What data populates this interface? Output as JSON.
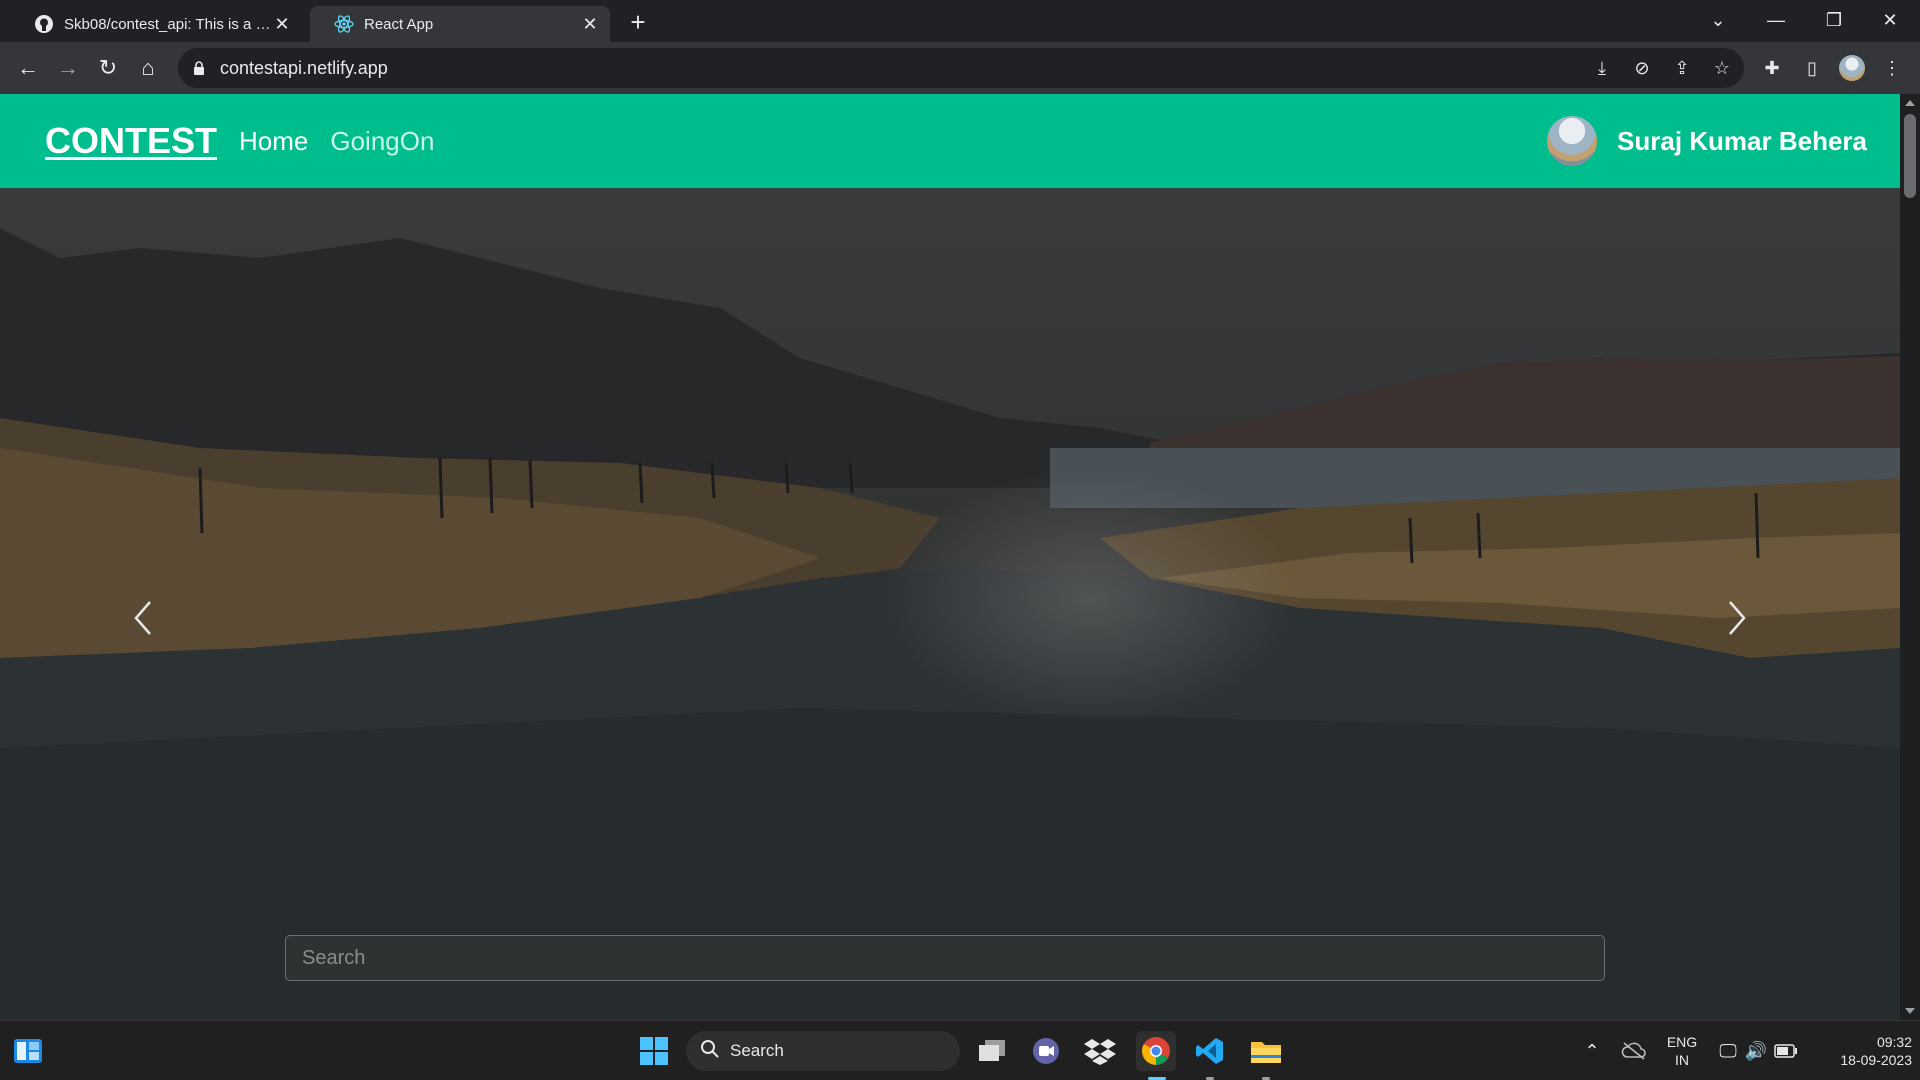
{
  "browser": {
    "tabs": [
      {
        "title": "Skb08/contest_api: This is a react",
        "icon": "github-icon"
      },
      {
        "title": "React App",
        "icon": "react-icon"
      }
    ],
    "new_tab_symbol": "+",
    "url": "contestapi.netlify.app"
  },
  "navbar": {
    "brand": "CONTEST",
    "links": [
      "Home",
      "GoingOn"
    ],
    "user_name": "Suraj Kumar Behera",
    "bg_color": "#00bd8e"
  },
  "carousel": {
    "prev_icon": "chevron-left-icon",
    "next_icon": "chevron-right-icon"
  },
  "search": {
    "placeholder": "Search"
  },
  "taskbar": {
    "search_label": "Search",
    "lang_top": "ENG",
    "lang_bottom": "IN",
    "time": "09:32",
    "date": "18-09-2023"
  }
}
